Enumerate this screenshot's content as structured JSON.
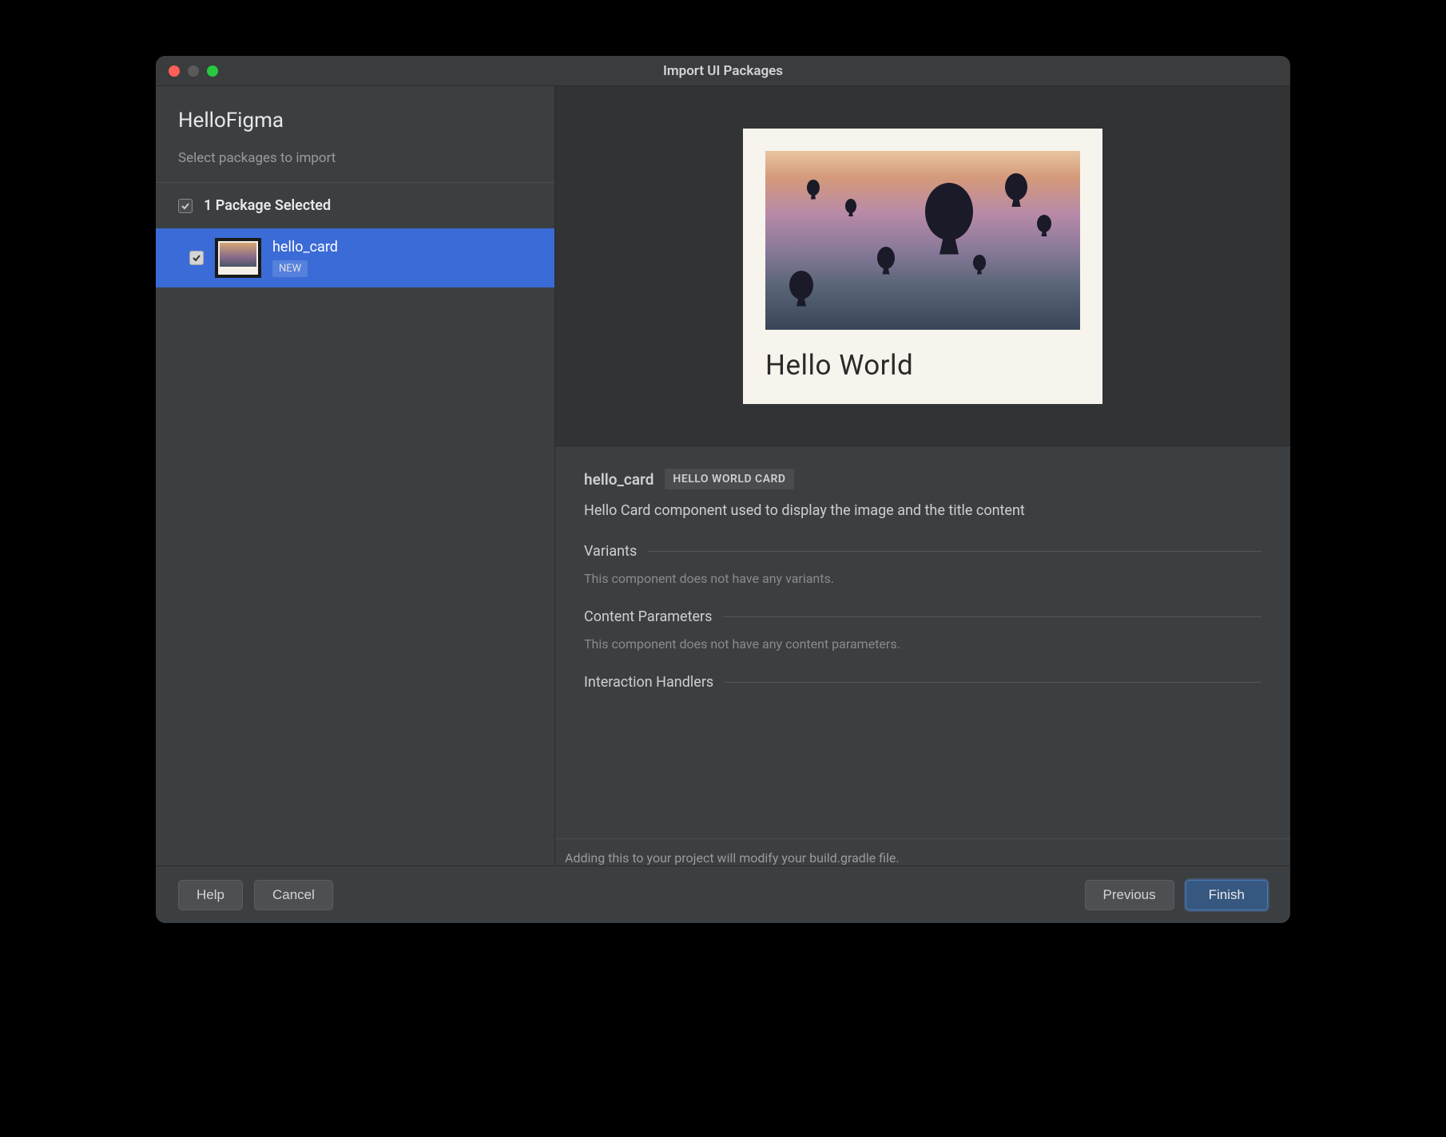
{
  "window": {
    "title": "Import UI Packages"
  },
  "sidebar": {
    "project_title": "HelloFigma",
    "subtitle": "Select packages to import",
    "selected_label": "1 Package Selected",
    "package": {
      "name": "hello_card",
      "badge": "NEW"
    }
  },
  "preview": {
    "card_title": "Hello World"
  },
  "details": {
    "name": "hello_card",
    "badge": "HELLO WORLD CARD",
    "description": "Hello Card component used to display the image and the title content",
    "sections": {
      "variants": {
        "title": "Variants",
        "text": "This component does not have any variants."
      },
      "content_params": {
        "title": "Content Parameters",
        "text": "This component does not have any content parameters."
      },
      "interaction": {
        "title": "Interaction Handlers"
      }
    },
    "footer_note": "Adding this to your project will modify your build.gradle file."
  },
  "buttons": {
    "help": "Help",
    "cancel": "Cancel",
    "previous": "Previous",
    "finish": "Finish"
  }
}
